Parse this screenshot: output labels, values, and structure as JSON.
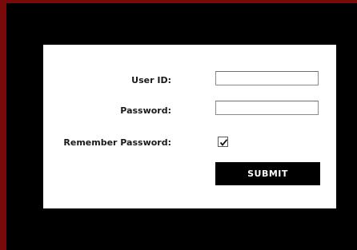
{
  "login": {
    "user_id_label": "User ID:",
    "user_id_value": "",
    "password_label": "Password:",
    "password_value": "",
    "remember_label": "Remember Password:",
    "remember_checked": true,
    "submit_label": "SUBMIT"
  },
  "colors": {
    "frame_border": "#7a0a0a",
    "frame_background": "#000000",
    "panel_background": "#ffffff",
    "button_background": "#000000",
    "button_text": "#ffffff"
  },
  "icons": {
    "remember_check": "checkmark-icon"
  }
}
